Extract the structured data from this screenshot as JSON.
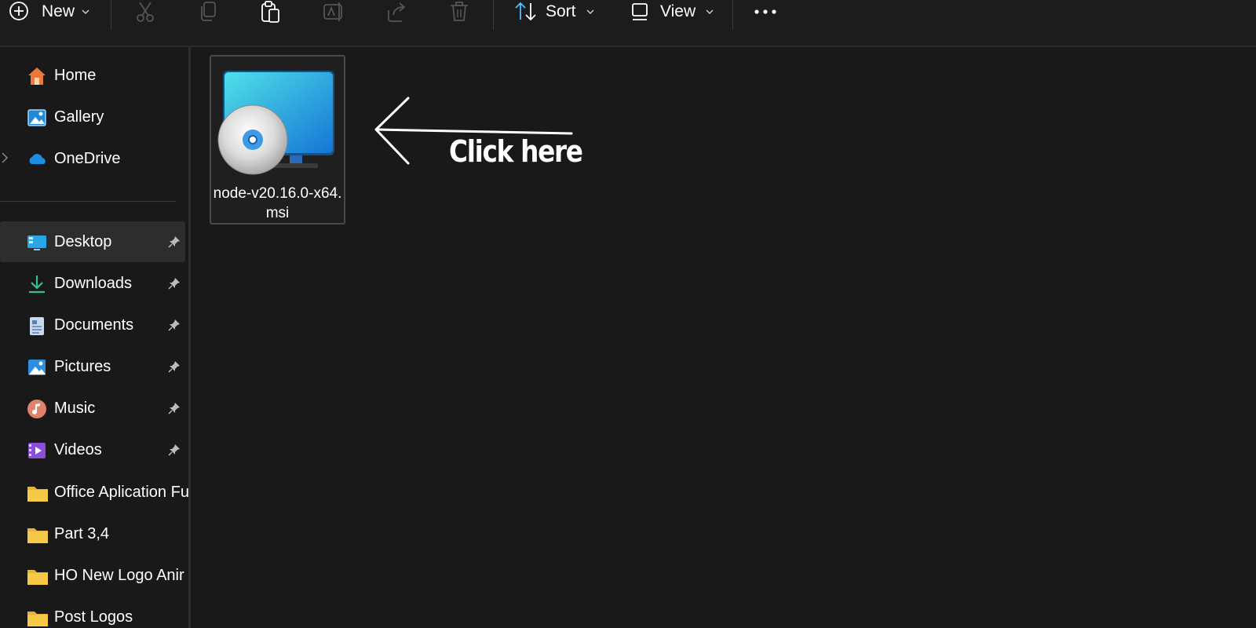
{
  "toolbar": {
    "new_label": "New",
    "sort_label": "Sort",
    "view_label": "View"
  },
  "sidebar": {
    "quick": [
      {
        "label": "Home",
        "icon": "home-icon"
      },
      {
        "label": "Gallery",
        "icon": "gallery-icon"
      },
      {
        "label": "OneDrive",
        "icon": "onedrive-icon"
      }
    ],
    "pinned": [
      {
        "label": "Desktop",
        "icon": "desktop-icon",
        "selected": true
      },
      {
        "label": "Downloads",
        "icon": "downloads-icon"
      },
      {
        "label": "Documents",
        "icon": "documents-icon"
      },
      {
        "label": "Pictures",
        "icon": "pictures-icon"
      },
      {
        "label": "Music",
        "icon": "music-icon"
      },
      {
        "label": "Videos",
        "icon": "videos-icon"
      }
    ],
    "folders": [
      {
        "label": "Office Aplication Fu",
        "icon": "folder-icon"
      },
      {
        "label": "Part 3,4",
        "icon": "folder-icon"
      },
      {
        "label": "HO New Logo Anir",
        "icon": "folder-icon"
      },
      {
        "label": "Post Logos",
        "icon": "folder-icon"
      }
    ]
  },
  "files": [
    {
      "name": "node-v20.16.0-x64.msi",
      "icon": "msi-installer-icon"
    }
  ],
  "annotation": {
    "text": "Click here"
  },
  "colors": {
    "background": "#191919",
    "selected": "#2d2d2d",
    "accent": "#4cc2ff",
    "folder": "#f7c948"
  }
}
